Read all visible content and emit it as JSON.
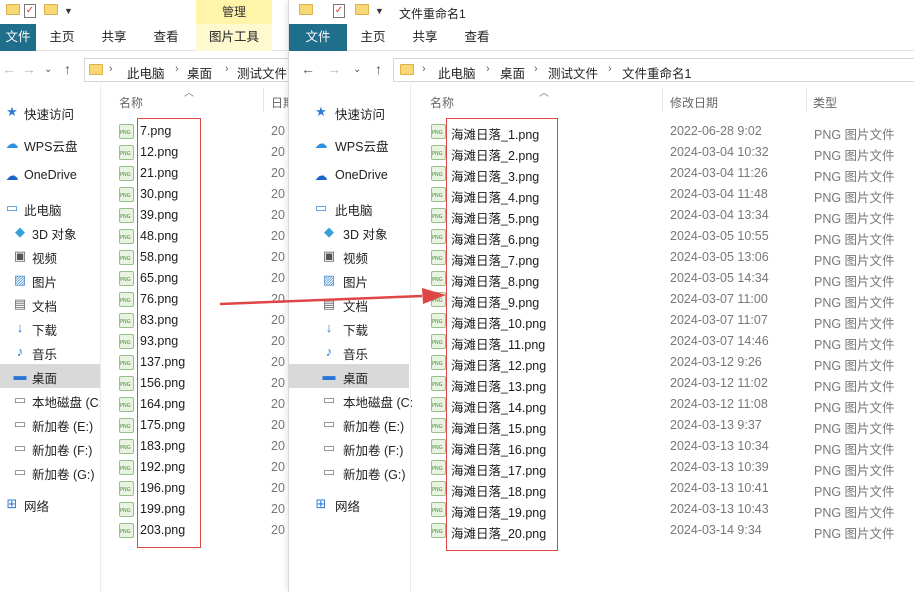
{
  "colors": {
    "accent": "#1f6e8c",
    "manage_tab": "#fff4a8",
    "highlight": "#e04545"
  },
  "left": {
    "ribbon": {
      "file": "文件",
      "home": "主页",
      "share": "共享",
      "view": "查看",
      "manage": "管理",
      "picture_tools": "图片工具"
    },
    "breadcrumb": [
      "此电脑",
      "桌面",
      "测试文件"
    ],
    "columns": {
      "name": "名称",
      "date": "日期"
    },
    "sidebar": [
      {
        "label": "快速访问",
        "icon": "star-icon"
      },
      {
        "label": "WPS云盘",
        "icon": "cloud-icon"
      },
      {
        "label": "OneDrive",
        "icon": "onedrive-icon"
      },
      {
        "label": "此电脑",
        "icon": "computer-icon"
      },
      {
        "label": "3D 对象",
        "icon": "cube-icon"
      },
      {
        "label": "视频",
        "icon": "video-icon"
      },
      {
        "label": "图片",
        "icon": "picture-icon"
      },
      {
        "label": "文档",
        "icon": "document-icon"
      },
      {
        "label": "下载",
        "icon": "download-icon"
      },
      {
        "label": "音乐",
        "icon": "music-icon"
      },
      {
        "label": "桌面",
        "icon": "desktop-icon"
      },
      {
        "label": "本地磁盘 (C:",
        "icon": "drive-icon"
      },
      {
        "label": "新加卷 (E:)",
        "icon": "drive-icon"
      },
      {
        "label": "新加卷 (F:)",
        "icon": "drive-icon"
      },
      {
        "label": "新加卷 (G:)",
        "icon": "drive-icon"
      },
      {
        "label": "网络",
        "icon": "network-icon"
      }
    ],
    "files": [
      {
        "name": "7.png",
        "date": "20"
      },
      {
        "name": "12.png",
        "date": "20"
      },
      {
        "name": "21.png",
        "date": "20"
      },
      {
        "name": "30.png",
        "date": "20"
      },
      {
        "name": "39.png",
        "date": "20"
      },
      {
        "name": "48.png",
        "date": "20"
      },
      {
        "name": "58.png",
        "date": "20"
      },
      {
        "name": "65.png",
        "date": "20"
      },
      {
        "name": "76.png",
        "date": "20"
      },
      {
        "name": "83.png",
        "date": "20"
      },
      {
        "name": "93.png",
        "date": "20"
      },
      {
        "name": "137.png",
        "date": "20"
      },
      {
        "name": "156.png",
        "date": "20"
      },
      {
        "name": "164.png",
        "date": "20"
      },
      {
        "name": "175.png",
        "date": "20"
      },
      {
        "name": "183.png",
        "date": "20"
      },
      {
        "name": "192.png",
        "date": "20"
      },
      {
        "name": "196.png",
        "date": "20"
      },
      {
        "name": "199.png",
        "date": "20"
      },
      {
        "name": "203.png",
        "date": "20"
      }
    ]
  },
  "right": {
    "title": "文件重命名1",
    "ribbon": {
      "file": "文件",
      "home": "主页",
      "share": "共享",
      "view": "查看"
    },
    "breadcrumb": [
      "此电脑",
      "桌面",
      "测试文件",
      "文件重命名1"
    ],
    "columns": {
      "name": "名称",
      "date": "修改日期",
      "type": "类型"
    },
    "sidebar": [
      {
        "label": "快速访问",
        "icon": "star-icon"
      },
      {
        "label": "WPS云盘",
        "icon": "cloud-icon"
      },
      {
        "label": "OneDrive",
        "icon": "onedrive-icon"
      },
      {
        "label": "此电脑",
        "icon": "computer-icon"
      },
      {
        "label": "3D 对象",
        "icon": "cube-icon"
      },
      {
        "label": "视频",
        "icon": "video-icon"
      },
      {
        "label": "图片",
        "icon": "picture-icon"
      },
      {
        "label": "文档",
        "icon": "document-icon"
      },
      {
        "label": "下载",
        "icon": "download-icon"
      },
      {
        "label": "音乐",
        "icon": "music-icon"
      },
      {
        "label": "桌面",
        "icon": "desktop-icon"
      },
      {
        "label": "本地磁盘 (C:",
        "icon": "drive-icon"
      },
      {
        "label": "新加卷 (E:)",
        "icon": "drive-icon"
      },
      {
        "label": "新加卷 (F:)",
        "icon": "drive-icon"
      },
      {
        "label": "新加卷 (G:)",
        "icon": "drive-icon"
      },
      {
        "label": "网络",
        "icon": "network-icon"
      }
    ],
    "files": [
      {
        "name": "海滩日落_1.png",
        "date": "2022-06-28 9:02",
        "type": "PNG 图片文件"
      },
      {
        "name": "海滩日落_2.png",
        "date": "2024-03-04 10:32",
        "type": "PNG 图片文件"
      },
      {
        "name": "海滩日落_3.png",
        "date": "2024-03-04 11:26",
        "type": "PNG 图片文件"
      },
      {
        "name": "海滩日落_4.png",
        "date": "2024-03-04 11:48",
        "type": "PNG 图片文件"
      },
      {
        "name": "海滩日落_5.png",
        "date": "2024-03-04 13:34",
        "type": "PNG 图片文件"
      },
      {
        "name": "海滩日落_6.png",
        "date": "2024-03-05 10:55",
        "type": "PNG 图片文件"
      },
      {
        "name": "海滩日落_7.png",
        "date": "2024-03-05 13:06",
        "type": "PNG 图片文件"
      },
      {
        "name": "海滩日落_8.png",
        "date": "2024-03-05 14:34",
        "type": "PNG 图片文件"
      },
      {
        "name": "海滩日落_9.png",
        "date": "2024-03-07 11:00",
        "type": "PNG 图片文件"
      },
      {
        "name": "海滩日落_10.png",
        "date": "2024-03-07 11:07",
        "type": "PNG 图片文件"
      },
      {
        "name": "海滩日落_11.png",
        "date": "2024-03-07 14:46",
        "type": "PNG 图片文件"
      },
      {
        "name": "海滩日落_12.png",
        "date": "2024-03-12 9:26",
        "type": "PNG 图片文件"
      },
      {
        "name": "海滩日落_13.png",
        "date": "2024-03-12 11:02",
        "type": "PNG 图片文件"
      },
      {
        "name": "海滩日落_14.png",
        "date": "2024-03-12 11:08",
        "type": "PNG 图片文件"
      },
      {
        "name": "海滩日落_15.png",
        "date": "2024-03-13 9:37",
        "type": "PNG 图片文件"
      },
      {
        "name": "海滩日落_16.png",
        "date": "2024-03-13 10:34",
        "type": "PNG 图片文件"
      },
      {
        "name": "海滩日落_17.png",
        "date": "2024-03-13 10:39",
        "type": "PNG 图片文件"
      },
      {
        "name": "海滩日落_18.png",
        "date": "2024-03-13 10:41",
        "type": "PNG 图片文件"
      },
      {
        "name": "海滩日落_19.png",
        "date": "2024-03-13 10:43",
        "type": "PNG 图片文件"
      },
      {
        "name": "海滩日落_20.png",
        "date": "2024-03-14 9:34",
        "type": "PNG 图片文件"
      }
    ]
  }
}
